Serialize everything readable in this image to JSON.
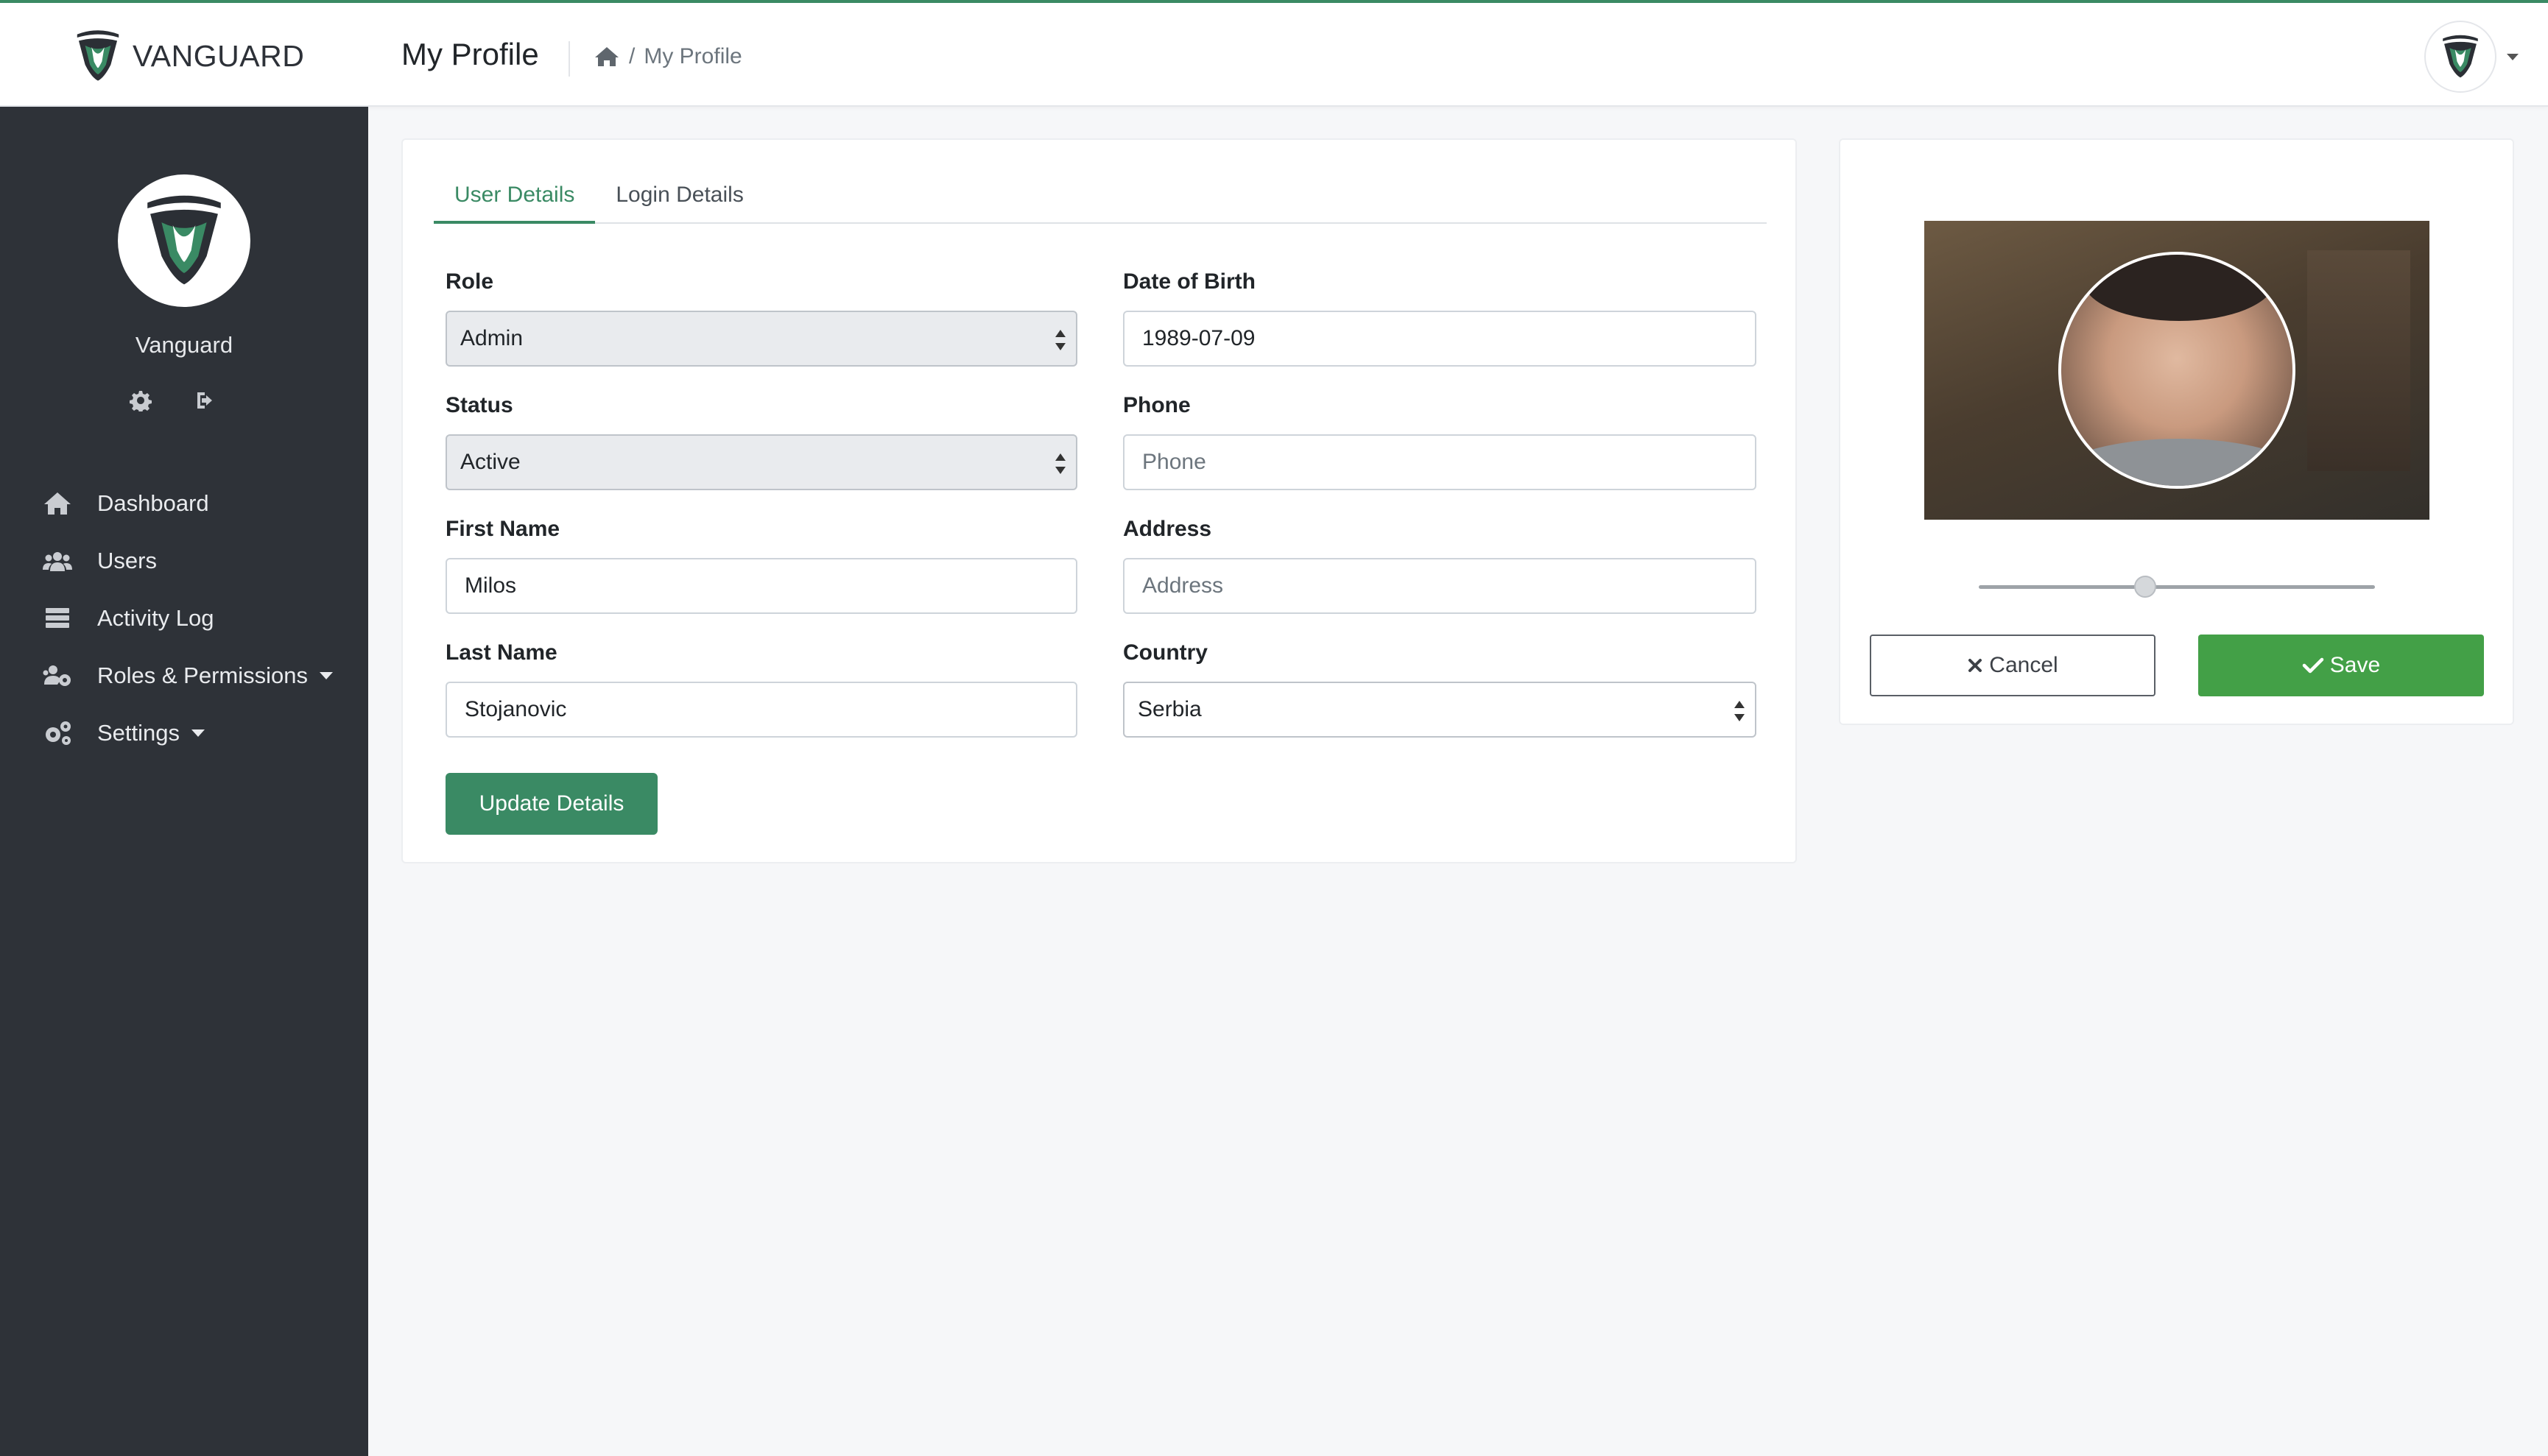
{
  "app": {
    "brand_prefix": "VAN",
    "brand_suffix": "GUARD",
    "accent_color": "#3a8a64",
    "sidebar_color": "#2e3238"
  },
  "header": {
    "title": "My Profile",
    "breadcrumb": {
      "home_icon": "home-icon",
      "separator": "/",
      "current": "My Profile"
    }
  },
  "sidebar": {
    "user_name": "Vanguard",
    "actions": [
      {
        "icon": "gear-icon"
      },
      {
        "icon": "logout-icon"
      }
    ],
    "items": [
      {
        "label": "Dashboard",
        "icon": "home-icon"
      },
      {
        "label": "Users",
        "icon": "users-icon"
      },
      {
        "label": "Activity Log",
        "icon": "server-icon"
      },
      {
        "label": "Roles & Permissions",
        "icon": "users-cog-icon",
        "has_caret": true
      },
      {
        "label": "Settings",
        "icon": "gears-icon",
        "has_caret": true
      }
    ]
  },
  "tabs": [
    {
      "label": "User Details",
      "active": true
    },
    {
      "label": "Login Details",
      "active": false
    }
  ],
  "form": {
    "role": {
      "label": "Role",
      "value": "Admin"
    },
    "status": {
      "label": "Status",
      "value": "Active"
    },
    "first_name": {
      "label": "First Name",
      "value": "Milos"
    },
    "last_name": {
      "label": "Last Name",
      "value": "Stojanovic"
    },
    "dob": {
      "label": "Date of Birth",
      "value": "1989-07-09"
    },
    "phone": {
      "label": "Phone",
      "value": "",
      "placeholder": "Phone"
    },
    "address": {
      "label": "Address",
      "value": "",
      "placeholder": "Address"
    },
    "country": {
      "label": "Country",
      "value": "Serbia"
    },
    "submit_label": "Update Details"
  },
  "avatar_editor": {
    "zoom_level": 0.42,
    "cancel_label": "Cancel",
    "save_label": "Save",
    "save_color": "#43a047"
  }
}
